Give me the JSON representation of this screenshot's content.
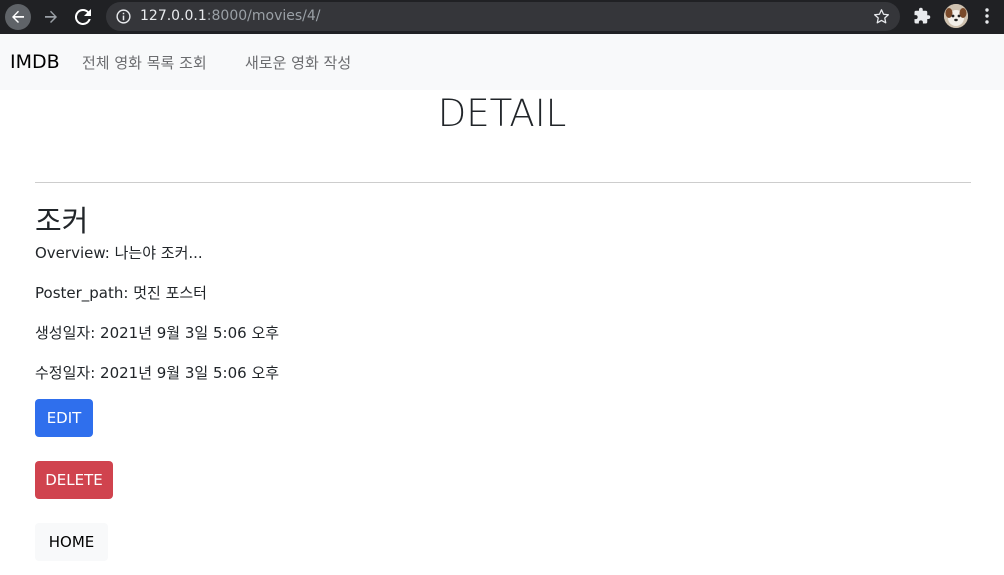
{
  "browser": {
    "url_host": "127.0.0.1",
    "url_rest": ":8000/movies/4/"
  },
  "navbar": {
    "brand": "IMDB",
    "links": [
      "전체 영화 목록 조회",
      "새로운 영화 작성"
    ]
  },
  "page": {
    "title": "DETAIL"
  },
  "movie": {
    "title": "조커",
    "overview": "Overview: 나는야 조커...",
    "poster_path": "Poster_path: 멋진 포스터",
    "created": "생성일자: 2021년 9월 3일 5:06 오후",
    "updated": "수정일자: 2021년 9월 3일 5:06 오후"
  },
  "buttons": {
    "edit": "EDIT",
    "delete": "DELETE",
    "home": "HOME"
  },
  "colors": {
    "edit_bg": "#2f6fed",
    "delete_bg": "#d0434e",
    "navbar_bg": "#f8f9fa"
  }
}
